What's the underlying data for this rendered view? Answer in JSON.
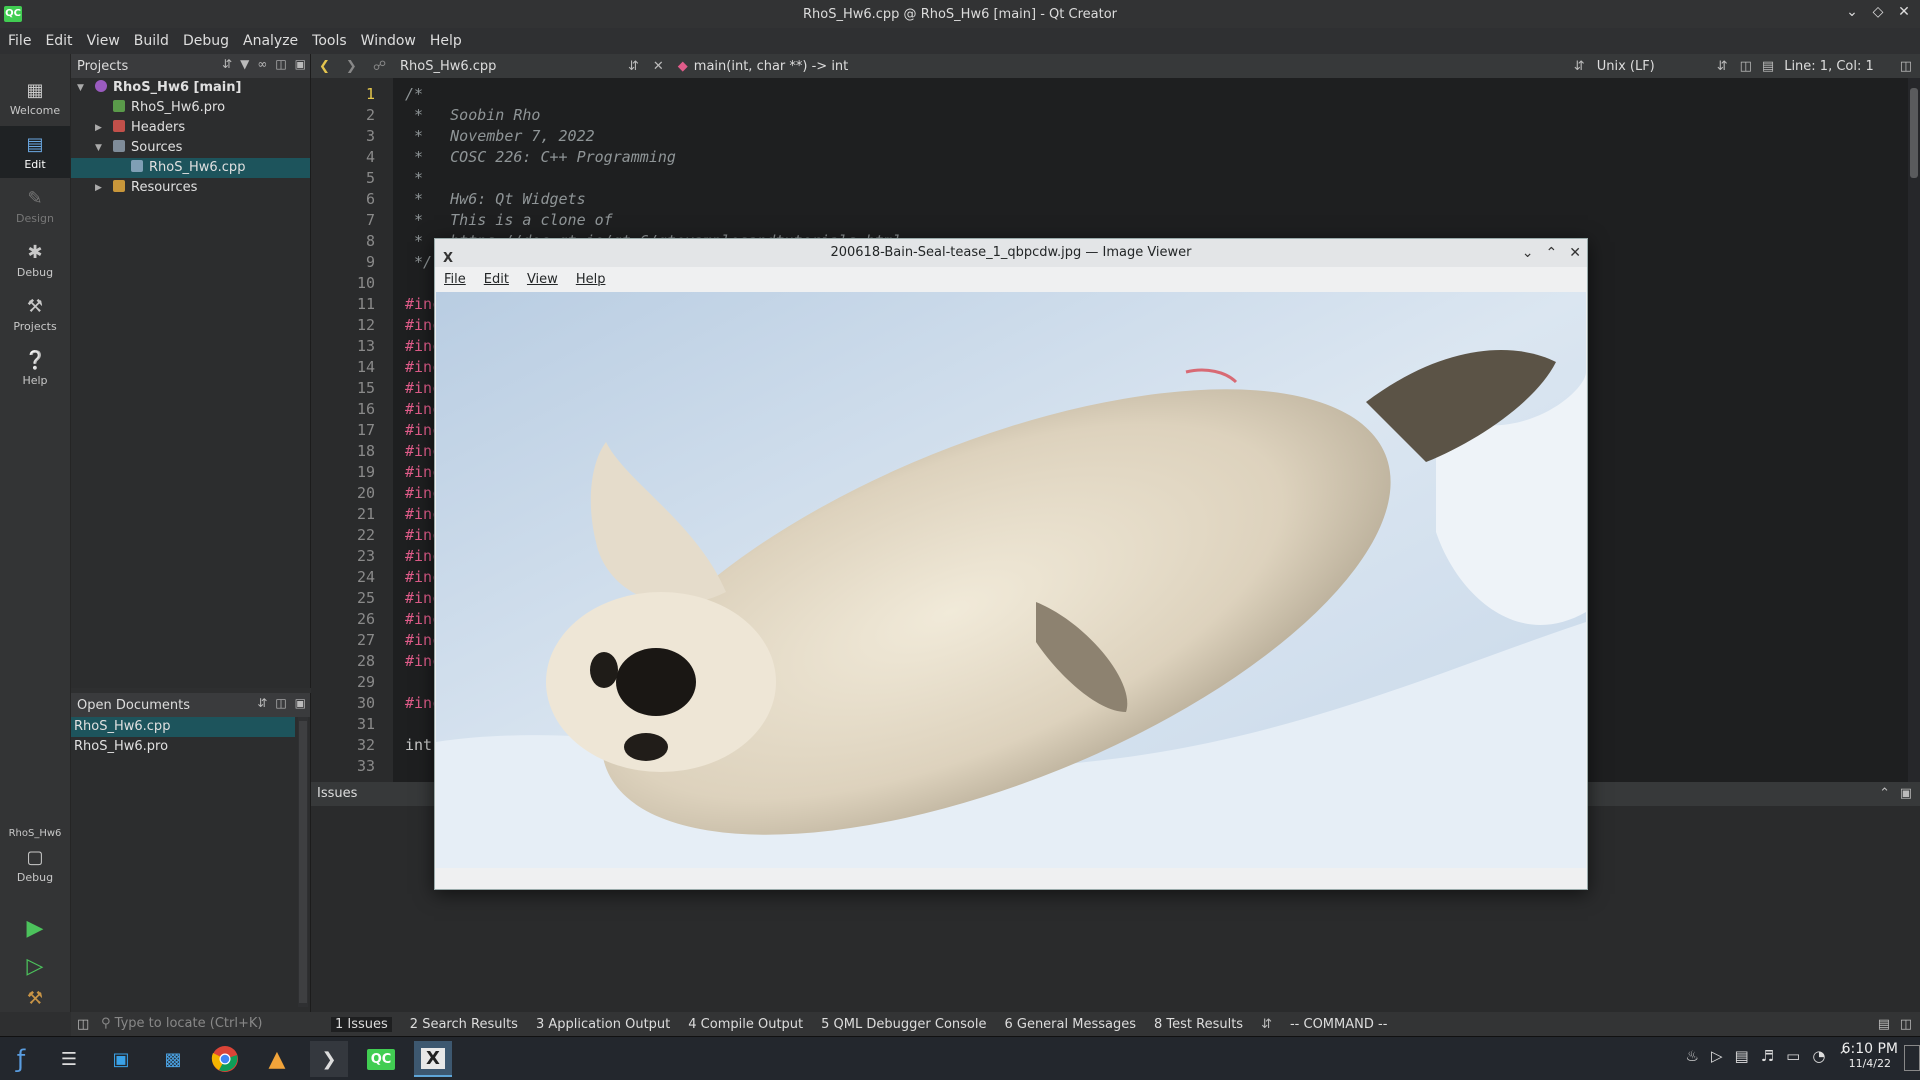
{
  "window": {
    "title": "RhoS_Hw6.cpp @ RhoS_Hw6 [main] - Qt Creator",
    "app_icon": "QC"
  },
  "menu": [
    "File",
    "Edit",
    "View",
    "Build",
    "Debug",
    "Analyze",
    "Tools",
    "Window",
    "Help"
  ],
  "modes": [
    {
      "label": "Welcome"
    },
    {
      "label": "Edit"
    },
    {
      "label": "Design"
    },
    {
      "label": "Debug"
    },
    {
      "label": "Projects"
    },
    {
      "label": "Help"
    }
  ],
  "target": {
    "project": "RhoS_Hw6",
    "mode": "Debug"
  },
  "projects": {
    "title": "Projects",
    "tree": [
      {
        "label": "RhoS_Hw6 [main]"
      },
      {
        "label": "RhoS_Hw6.pro"
      },
      {
        "label": "Headers"
      },
      {
        "label": "Sources"
      },
      {
        "label": "RhoS_Hw6.cpp"
      },
      {
        "label": "Resources"
      }
    ]
  },
  "open_documents": {
    "title": "Open Documents",
    "items": [
      "RhoS_Hw6.cpp",
      "RhoS_Hw6.pro"
    ]
  },
  "editor": {
    "file": "RhoS_Hw6.cpp",
    "symbol": "main(int, char **) -> int",
    "line_ending": "Unix (LF)",
    "position": "Line: 1, Col: 1",
    "lines": [
      {
        "n": "1",
        "t": "/*"
      },
      {
        "n": "2",
        "t": " *   Soobin Rho"
      },
      {
        "n": "3",
        "t": " *   November 7, 2022"
      },
      {
        "n": "4",
        "t": " *   COSC 226: C++ Programming"
      },
      {
        "n": "5",
        "t": " *"
      },
      {
        "n": "6",
        "t": " *   Hw6: Qt Widgets"
      },
      {
        "n": "7",
        "t": " *   This is a clone of"
      },
      {
        "n": "8",
        "t": " *   https://doc.qt.io/qt-6/qtexamplesandtutorials.html"
      },
      {
        "n": "9",
        "t": " */"
      },
      {
        "n": "10",
        "t": ""
      },
      {
        "n": "11",
        "t": "#inc"
      },
      {
        "n": "12",
        "t": "#inc"
      },
      {
        "n": "13",
        "t": "#inc"
      },
      {
        "n": "14",
        "t": "#inc"
      },
      {
        "n": "15",
        "t": "#inc"
      },
      {
        "n": "16",
        "t": "#inc"
      },
      {
        "n": "17",
        "t": "#inc"
      },
      {
        "n": "18",
        "t": "#inc"
      },
      {
        "n": "19",
        "t": "#inc"
      },
      {
        "n": "20",
        "t": "#inc"
      },
      {
        "n": "21",
        "t": "#inc"
      },
      {
        "n": "22",
        "t": "#inc"
      },
      {
        "n": "23",
        "t": "#inc"
      },
      {
        "n": "24",
        "t": "#inc"
      },
      {
        "n": "25",
        "t": "#inc"
      },
      {
        "n": "26",
        "t": "#inc"
      },
      {
        "n": "27",
        "t": "#inc"
      },
      {
        "n": "28",
        "t": "#inc"
      },
      {
        "n": "29",
        "t": ""
      },
      {
        "n": "30",
        "t": "#inc"
      },
      {
        "n": "31",
        "t": ""
      },
      {
        "n": "32",
        "t": "int m"
      },
      {
        "n": "33",
        "t": ""
      }
    ]
  },
  "issues_panel": {
    "title": "Issues"
  },
  "status": {
    "locate_placeholder": "Type to locate (Ctrl+K)",
    "tabs": [
      "1  Issues",
      "2  Search Results",
      "3  Application Output",
      "4  Compile Output",
      "5  QML Debugger Console",
      "6  General Messages",
      "8  Test Results"
    ],
    "mode_text": "-- COMMAND --"
  },
  "viewer": {
    "title": "200618-Bain-Seal-tease_1_qbpcdw.jpg — Image Viewer",
    "menu": [
      "File",
      "Edit",
      "View",
      "Help"
    ]
  },
  "clock": {
    "time": "6:10 PM",
    "date": "11/4/22"
  },
  "taskbar": {
    "qc_label": "QC"
  }
}
